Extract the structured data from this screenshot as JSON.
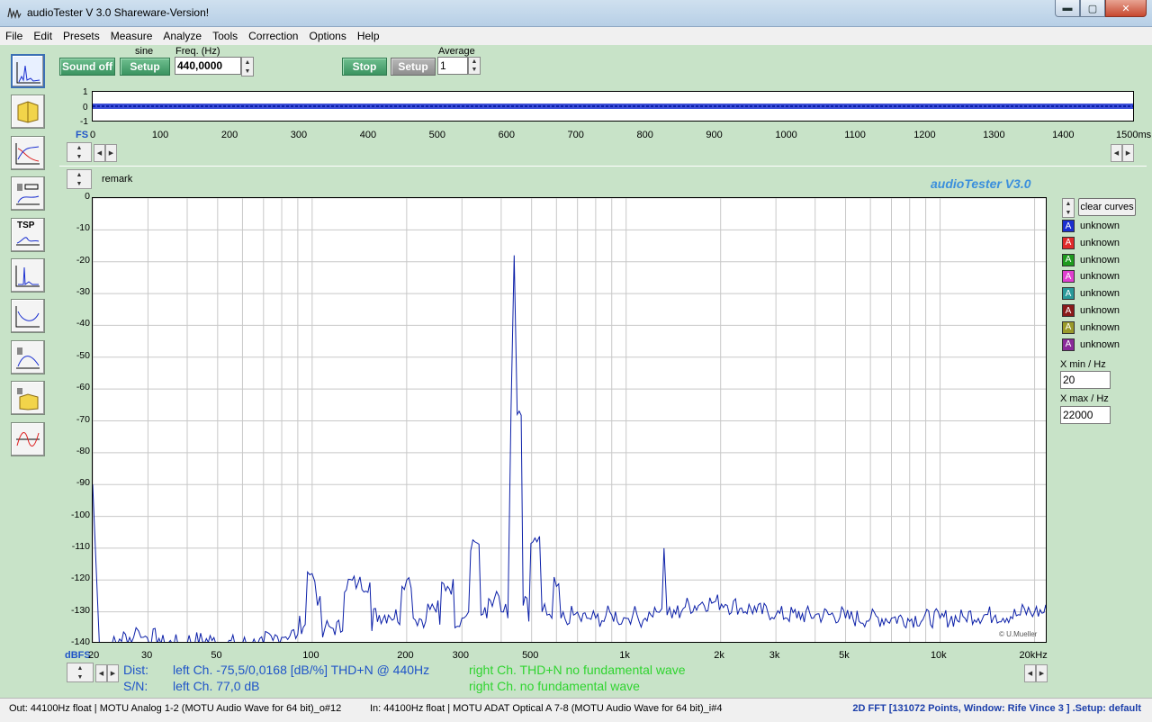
{
  "window": {
    "title": "audioTester  V 3.0 Shareware-Version!",
    "minimize": "▬",
    "maximize": "▢",
    "close": "✕"
  },
  "menu": [
    "File",
    "Edit",
    "Presets",
    "Measure",
    "Analyze",
    "Tools",
    "Correction",
    "Options",
    "Help"
  ],
  "generator": {
    "sound_off_label": "Sound off",
    "waveform": "sine",
    "setup_label": "Setup",
    "freq_label": "Freq. (Hz)",
    "freq_value": "440,0000"
  },
  "analyzer": {
    "stop_label": "Stop",
    "setup_label": "Setup",
    "average_label": "Average",
    "average_value": "1"
  },
  "scope": {
    "y_labels": [
      "1",
      "0",
      "-1"
    ],
    "fs_label": "FS",
    "x_labels": [
      "0",
      "100",
      "200",
      "300",
      "400",
      "500",
      "600",
      "700",
      "800",
      "900",
      "1000",
      "1100",
      "1200",
      "1300",
      "1400",
      "1500ms"
    ]
  },
  "fft": {
    "remark_label": "remark",
    "brand": "audioTester  V3.0",
    "y_unit": "dBFS",
    "copyright": "© U.Mueller",
    "clear_curves_label": "clear curves",
    "x_min_label": "X min / Hz",
    "x_min_value": "20",
    "x_max_label": "X max / Hz",
    "x_max_value": "22000"
  },
  "legend": [
    {
      "letter": "A",
      "label": "unknown",
      "color": "#1a2fd0"
    },
    {
      "letter": "A",
      "label": "unknown",
      "color": "#e02a2a"
    },
    {
      "letter": "A",
      "label": "unknown",
      "color": "#1f9a1f"
    },
    {
      "letter": "A",
      "label": "unknown",
      "color": "#e040d0"
    },
    {
      "letter": "A",
      "label": "unknown",
      "color": "#2a9a9a"
    },
    {
      "letter": "A",
      "label": "unknown",
      "color": "#8a1a1a"
    },
    {
      "letter": "A",
      "label": "unknown",
      "color": "#9a9a2a"
    },
    {
      "letter": "A",
      "label": "unknown",
      "color": "#8a2a9a"
    }
  ],
  "results": {
    "dist_label": "Dist:",
    "sn_label": "S/N:",
    "left_dist": "left Ch. -75,5/0,0168 [dB/%] THD+N  @ 440Hz",
    "left_sn": "left Ch. 77,0 dB",
    "right_dist": "right Ch. THD+N  no fundamental wave",
    "right_sn": "right Ch.  no fundamental wave"
  },
  "status": {
    "out": "Out: 44100Hz float  | MOTU Analog 1-2 (MOTU Audio Wave for 64 bit)_o#12",
    "in": "In: 44100Hz float  | MOTU ADAT Optical A 7-8 (MOTU Audio Wave for 64 bit)_i#4",
    "right": "2D FFT [131072 Points, Window: Rife Vince 3 ]  .Setup:  default"
  },
  "chart_data": {
    "type": "line",
    "x_scale": "log",
    "xlim": [
      20,
      22000
    ],
    "ylim": [
      -140,
      0
    ],
    "y_ticks": [
      0,
      -10,
      -20,
      -30,
      -40,
      -50,
      -60,
      -70,
      -80,
      -90,
      -100,
      -110,
      -120,
      -130,
      -140
    ],
    "x_tick_labels": [
      {
        "x": 20,
        "label": "20"
      },
      {
        "x": 30,
        "label": "30"
      },
      {
        "x": 50,
        "label": "50"
      },
      {
        "x": 100,
        "label": "100"
      },
      {
        "x": 200,
        "label": "200"
      },
      {
        "x": 300,
        "label": "300"
      },
      {
        "x": 500,
        "label": "500"
      },
      {
        "x": 1000,
        "label": "1k"
      },
      {
        "x": 2000,
        "label": "2k"
      },
      {
        "x": 3000,
        "label": "3k"
      },
      {
        "x": 5000,
        "label": "5k"
      },
      {
        "x": 10000,
        "label": "10k"
      },
      {
        "x": 20000,
        "label": "20kHz"
      }
    ],
    "grid": true,
    "series": [
      {
        "color": "#0b1fa8",
        "x": [
          20,
          20.5,
          21,
          24,
          27,
          28,
          29,
          33,
          40,
          48,
          50,
          60,
          70,
          75,
          80,
          90,
          95,
          100,
          104,
          108,
          115,
          125,
          140,
          155,
          175,
          190,
          200,
          210,
          230,
          245,
          255,
          270,
          285,
          300,
          315,
          330,
          345,
          360,
          380,
          400,
          420,
          430,
          440,
          450,
          470,
          490,
          520,
          540,
          560,
          580,
          600,
          620,
          650,
          680,
          720,
          760,
          800,
          850,
          900,
          950,
          1000,
          1050,
          1100,
          1150,
          1200,
          1250,
          1300,
          1320,
          1350,
          1400,
          1500,
          1700,
          1900,
          2100,
          2300,
          2600,
          3000,
          3500,
          4000,
          5000,
          6000,
          7000,
          8000,
          10000,
          12000,
          15000,
          18000,
          20000,
          22000
        ],
        "y": [
          -90,
          -115,
          -140,
          -140,
          -138,
          -136,
          -138,
          -140,
          -140,
          -139,
          -140,
          -140,
          -140,
          -139,
          -138,
          -137,
          -134,
          -118,
          -128,
          -138,
          -135,
          -136,
          -121,
          -136,
          -131,
          -134,
          -120,
          -132,
          -133,
          -129,
          -134,
          -122,
          -135,
          -132,
          -130,
          -108,
          -131,
          -132,
          -126,
          -130,
          -132,
          -67,
          -18,
          -68,
          -128,
          -133,
          -108,
          -130,
          -131,
          -132,
          -122,
          -132,
          -134,
          -131,
          -133,
          -132,
          -132,
          -133,
          -131,
          -134,
          -132,
          -131,
          -133,
          -132,
          -131,
          -130,
          -129,
          -110,
          -131,
          -132,
          -130,
          -128,
          -127,
          -128,
          -129,
          -130,
          -131,
          -132,
          -131,
          -132,
          -132,
          -132,
          -133,
          -132,
          -132,
          -131,
          -131,
          -130,
          -132
        ]
      }
    ]
  }
}
